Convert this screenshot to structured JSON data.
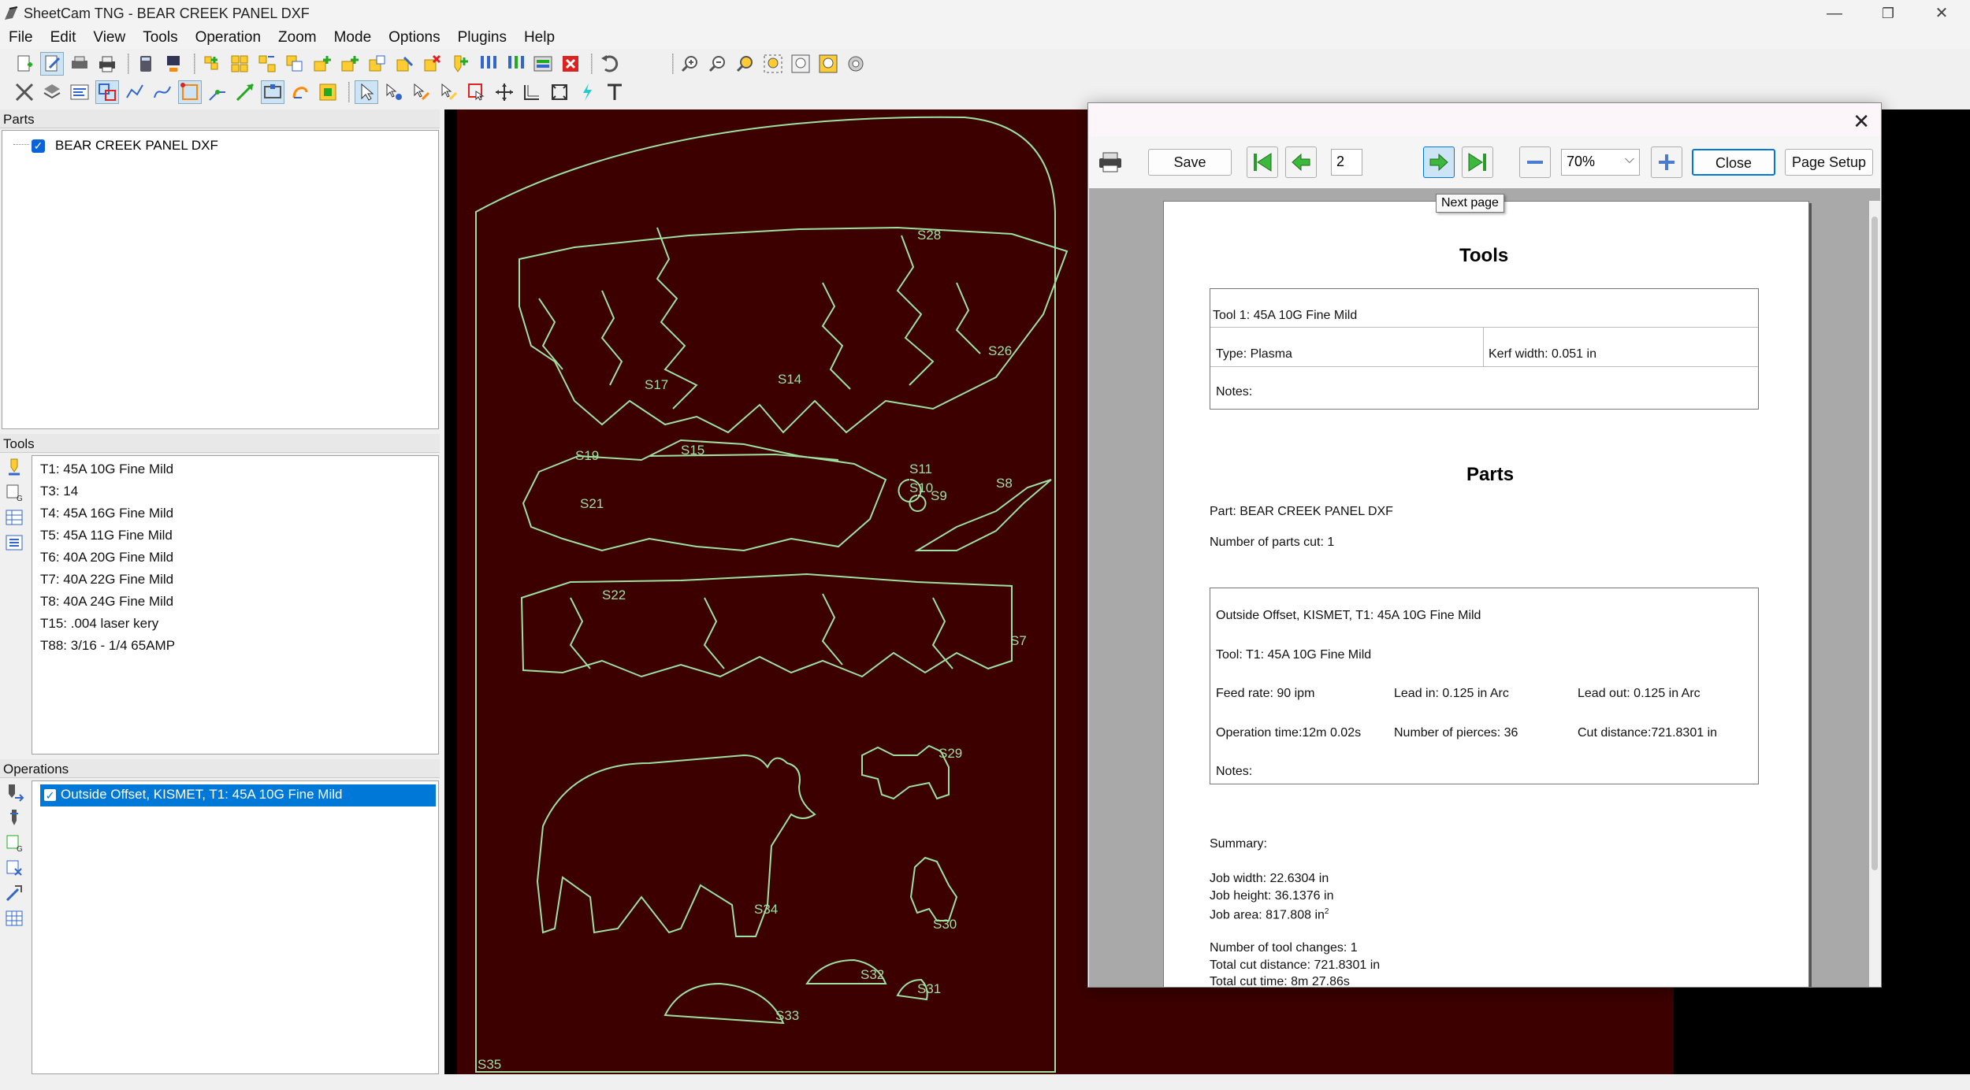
{
  "window": {
    "title": "SheetCam TNG - BEAR CREEK PANEL DXF",
    "minimize": "—",
    "maximize": "❐",
    "close": "✕"
  },
  "menu": [
    "File",
    "Edit",
    "View",
    "Tools",
    "Operation",
    "Zoom",
    "Mode",
    "Options",
    "Plugins",
    "Help"
  ],
  "parts_panel": {
    "header": "Parts",
    "item": "BEAR CREEK PANEL DXF"
  },
  "tools_panel": {
    "header": "Tools",
    "items": [
      "T1: 45A 10G Fine Mild",
      "T3: 14",
      "T4: 45A 16G Fine Mild",
      "T5: 45A 11G Fine Mild",
      "T6: 40A 20G Fine Mild",
      "T7: 40A 22G Fine Mild",
      "T8: 40A 24G Fine Mild",
      "T15: .004 laser kery",
      "T88: 3/16 - 1/4 65AMP"
    ]
  },
  "operations_panel": {
    "header": "Operations",
    "item": "Outside Offset, KISMET, T1: 45A 10G Fine Mild"
  },
  "canvas": {
    "labels": {
      "s28": "S28",
      "s26": "S26",
      "s14": "S14",
      "s17": "S17",
      "s19": "S19",
      "s15": "S15",
      "s11": "S11",
      "s10": "S10",
      "s9": "S9",
      "s8": "S8",
      "s21": "S21",
      "s22": "S22",
      "s7": "S7",
      "s29": "S29",
      "s34": "S34",
      "s33": "S33",
      "s32": "S32",
      "s31": "S31",
      "s30": "S30",
      "s35": "S35"
    },
    "colors": {
      "background": "#3d0000",
      "outline": "#9fe09f",
      "black": "#000000"
    }
  },
  "preview": {
    "save": "Save",
    "page_number": "2",
    "zoom": "70%",
    "close": "Close",
    "page_setup": "Page Setup",
    "tooltip": "Next page",
    "tools_heading": "Tools",
    "tool_line": "Tool 1: 45A 10G Fine Mild",
    "type": "Type: Plasma",
    "kerf": "Kerf width: 0.051 in",
    "tool_notes": "Notes:",
    "parts_heading": "Parts",
    "part": "Part: BEAR CREEK PANEL DXF",
    "parts_cut": "Number of parts cut: 1",
    "op_title": "Outside Offset, KISMET, T1: 45A 10G Fine Mild",
    "op_tool": "Tool: T1: 45A 10G Fine Mild",
    "feed": "Feed rate: 90 ipm",
    "lead_in": "Lead in: 0.125 in Arc",
    "lead_out": "Lead out: 0.125 in Arc",
    "op_time": "Operation time:12m 0.02s",
    "pierces": "Number of pierces: 36",
    "cut_dist": "Cut distance:721.8301 in",
    "op_notes": "Notes:",
    "summary": "Summary:",
    "job_width": "Job width: 22.6304 in",
    "job_height": "Job height: 36.1376 in",
    "job_area": "Job area: 817.808 in",
    "job_area_sup": "2",
    "tool_changes": "Number of tool changes: 1",
    "total_cut": "Total cut distance: 721.8301 in",
    "total_time": "Total cut time: 8m 27.86s"
  }
}
